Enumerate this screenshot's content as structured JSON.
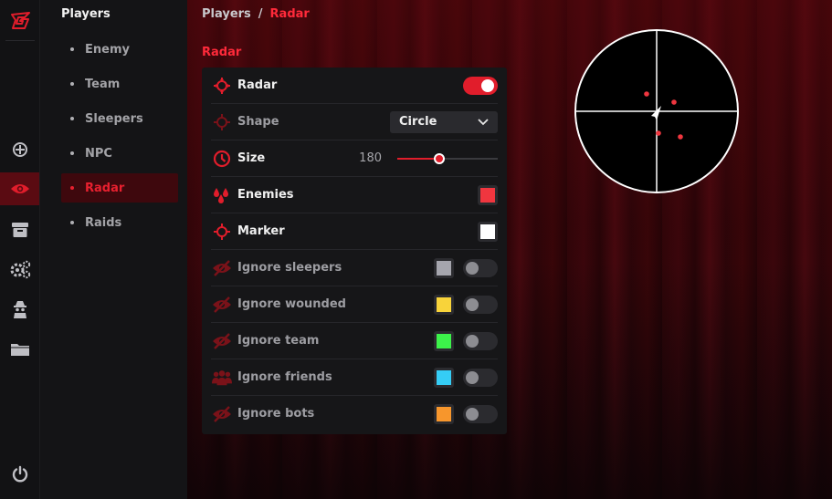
{
  "app": {
    "logo": "G-logo-icon"
  },
  "rail": {
    "items": [
      {
        "name": "crosshair-icon",
        "active": false
      },
      {
        "name": "eye-icon",
        "active": true
      },
      {
        "name": "archive-box-icon",
        "active": false
      },
      {
        "name": "gears-icon",
        "active": false
      },
      {
        "name": "spy-icon",
        "active": false
      },
      {
        "name": "folder-icon",
        "active": false
      }
    ],
    "power": "power-icon"
  },
  "nav": {
    "title": "Players",
    "items": [
      {
        "label": "Enemy",
        "active": false
      },
      {
        "label": "Team",
        "active": false
      },
      {
        "label": "Sleepers",
        "active": false
      },
      {
        "label": "NPC",
        "active": false
      },
      {
        "label": "Radar",
        "active": true
      },
      {
        "label": "Raids",
        "active": false
      }
    ]
  },
  "breadcrumb": {
    "parent": "Players",
    "separator": "/",
    "current": "Radar"
  },
  "section": {
    "title": "Radar"
  },
  "settings": {
    "radar": {
      "label": "Radar",
      "enabled": true
    },
    "shape": {
      "label": "Shape",
      "value": "Circle"
    },
    "size": {
      "label": "Size",
      "value": "180",
      "fraction": 0.42
    },
    "enemies": {
      "label": "Enemies",
      "color": "#f0363f"
    },
    "marker": {
      "label": "Marker",
      "color": "#ffffff"
    },
    "ignore_sleepers": {
      "label": "Ignore sleepers",
      "color": "#a5a5ad",
      "enabled": false
    },
    "ignore_wounded": {
      "label": "Ignore wounded",
      "color": "#f8d33a",
      "enabled": false
    },
    "ignore_team": {
      "label": "Ignore team",
      "color": "#3cf24a",
      "enabled": false
    },
    "ignore_friends": {
      "label": "Ignore friends",
      "color": "#35cdf5",
      "enabled": false
    },
    "ignore_bots": {
      "label": "Ignore bots",
      "color": "#f7962c",
      "enabled": false
    }
  },
  "colors": {
    "accent": "#e11d2b",
    "active_nav_bg": "#3e080d"
  }
}
